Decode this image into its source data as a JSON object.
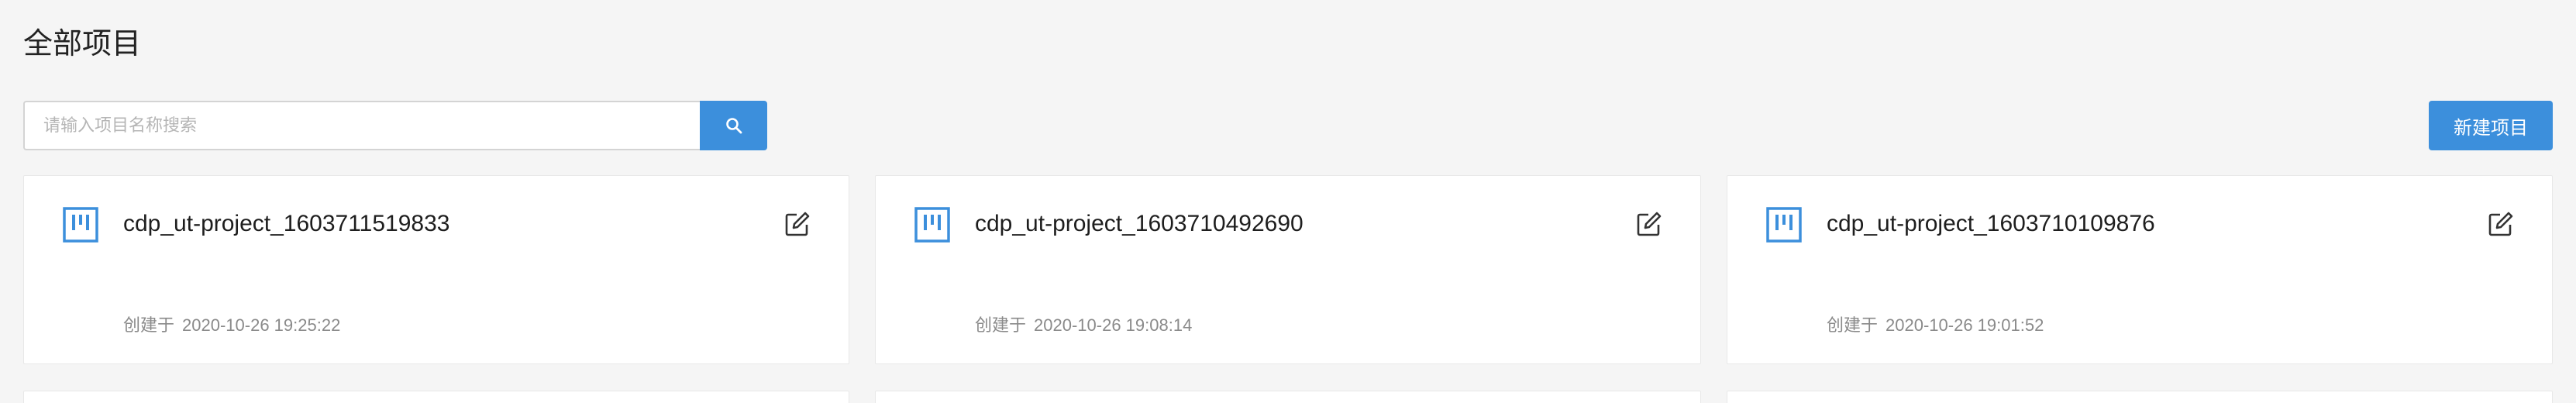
{
  "page": {
    "title": "全部项目"
  },
  "search": {
    "placeholder": "请输入项目名称搜索",
    "icon": "search-icon"
  },
  "toolbar": {
    "new_project_label": "新建项目"
  },
  "colors": {
    "accent": "#3c8fdc",
    "background": "#f5f5f5",
    "card": "#ffffff",
    "meta_text": "#8a8a8a"
  },
  "projects": [
    {
      "name": "cdp_ut-project_1603711519833",
      "created_label": "创建于",
      "created_at": "2020-10-26 19:25:22",
      "icon": "project-board-icon",
      "action_icon": "edit-icon"
    },
    {
      "name": "cdp_ut-project_1603710492690",
      "created_label": "创建于",
      "created_at": "2020-10-26 19:08:14",
      "icon": "project-board-icon",
      "action_icon": "edit-icon"
    },
    {
      "name": "cdp_ut-project_1603710109876",
      "created_label": "创建于",
      "created_at": "2020-10-26 19:01:52",
      "icon": "project-board-icon",
      "action_icon": "edit-icon"
    }
  ]
}
